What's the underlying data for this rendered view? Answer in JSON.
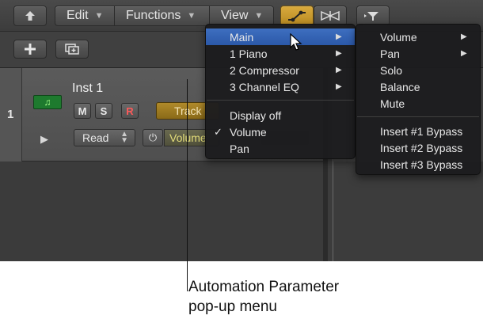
{
  "toolbar": {
    "up_icon": "up-arrow-icon",
    "edit_label": "Edit",
    "functions_label": "Functions",
    "view_label": "View",
    "automation_icon": "automation-curve-icon",
    "flex_icon": "flex-view-icon",
    "filter_icon": "filter-icon"
  },
  "track_list_toolbar": {
    "add_icon": "plus-icon",
    "duplicate_icon": "duplicate-track-icon"
  },
  "track": {
    "number": "1",
    "name": "Inst 1",
    "icon": "music-note-icon",
    "mute_label": "M",
    "solo_label": "S",
    "record_label": "R",
    "track_button_label": "Track",
    "automation_mode": "Read",
    "power_icon": "power-icon",
    "parameter": "Volume",
    "accent_color": "#b08a2a",
    "parameter_color": "#e4de7a"
  },
  "parameter_menu": {
    "items": [
      {
        "label": "Main",
        "submenu": true,
        "highlighted": true
      },
      {
        "label": "1 Piano",
        "submenu": true
      },
      {
        "label": "2 Compressor",
        "submenu": true
      },
      {
        "label": "3 Channel EQ",
        "submenu": true
      }
    ],
    "options": [
      {
        "label": "Display off",
        "checked": false
      },
      {
        "label": "Volume",
        "checked": true
      },
      {
        "label": "Pan",
        "checked": false
      }
    ],
    "check_mark": "✓",
    "highlight_color": "#3e6fc0"
  },
  "main_submenu": {
    "items": [
      {
        "label": "Volume",
        "submenu": true
      },
      {
        "label": "Pan",
        "submenu": true
      },
      {
        "label": "Solo",
        "submenu": false
      },
      {
        "label": "Balance",
        "submenu": false
      },
      {
        "label": "Mute",
        "submenu": false
      }
    ],
    "inserts": [
      {
        "label": "Insert #1 Bypass"
      },
      {
        "label": "Insert #2 Bypass"
      },
      {
        "label": "Insert #3 Bypass"
      }
    ]
  },
  "callout": {
    "line1": "Automation Parameter",
    "line2": "pop-up menu"
  }
}
